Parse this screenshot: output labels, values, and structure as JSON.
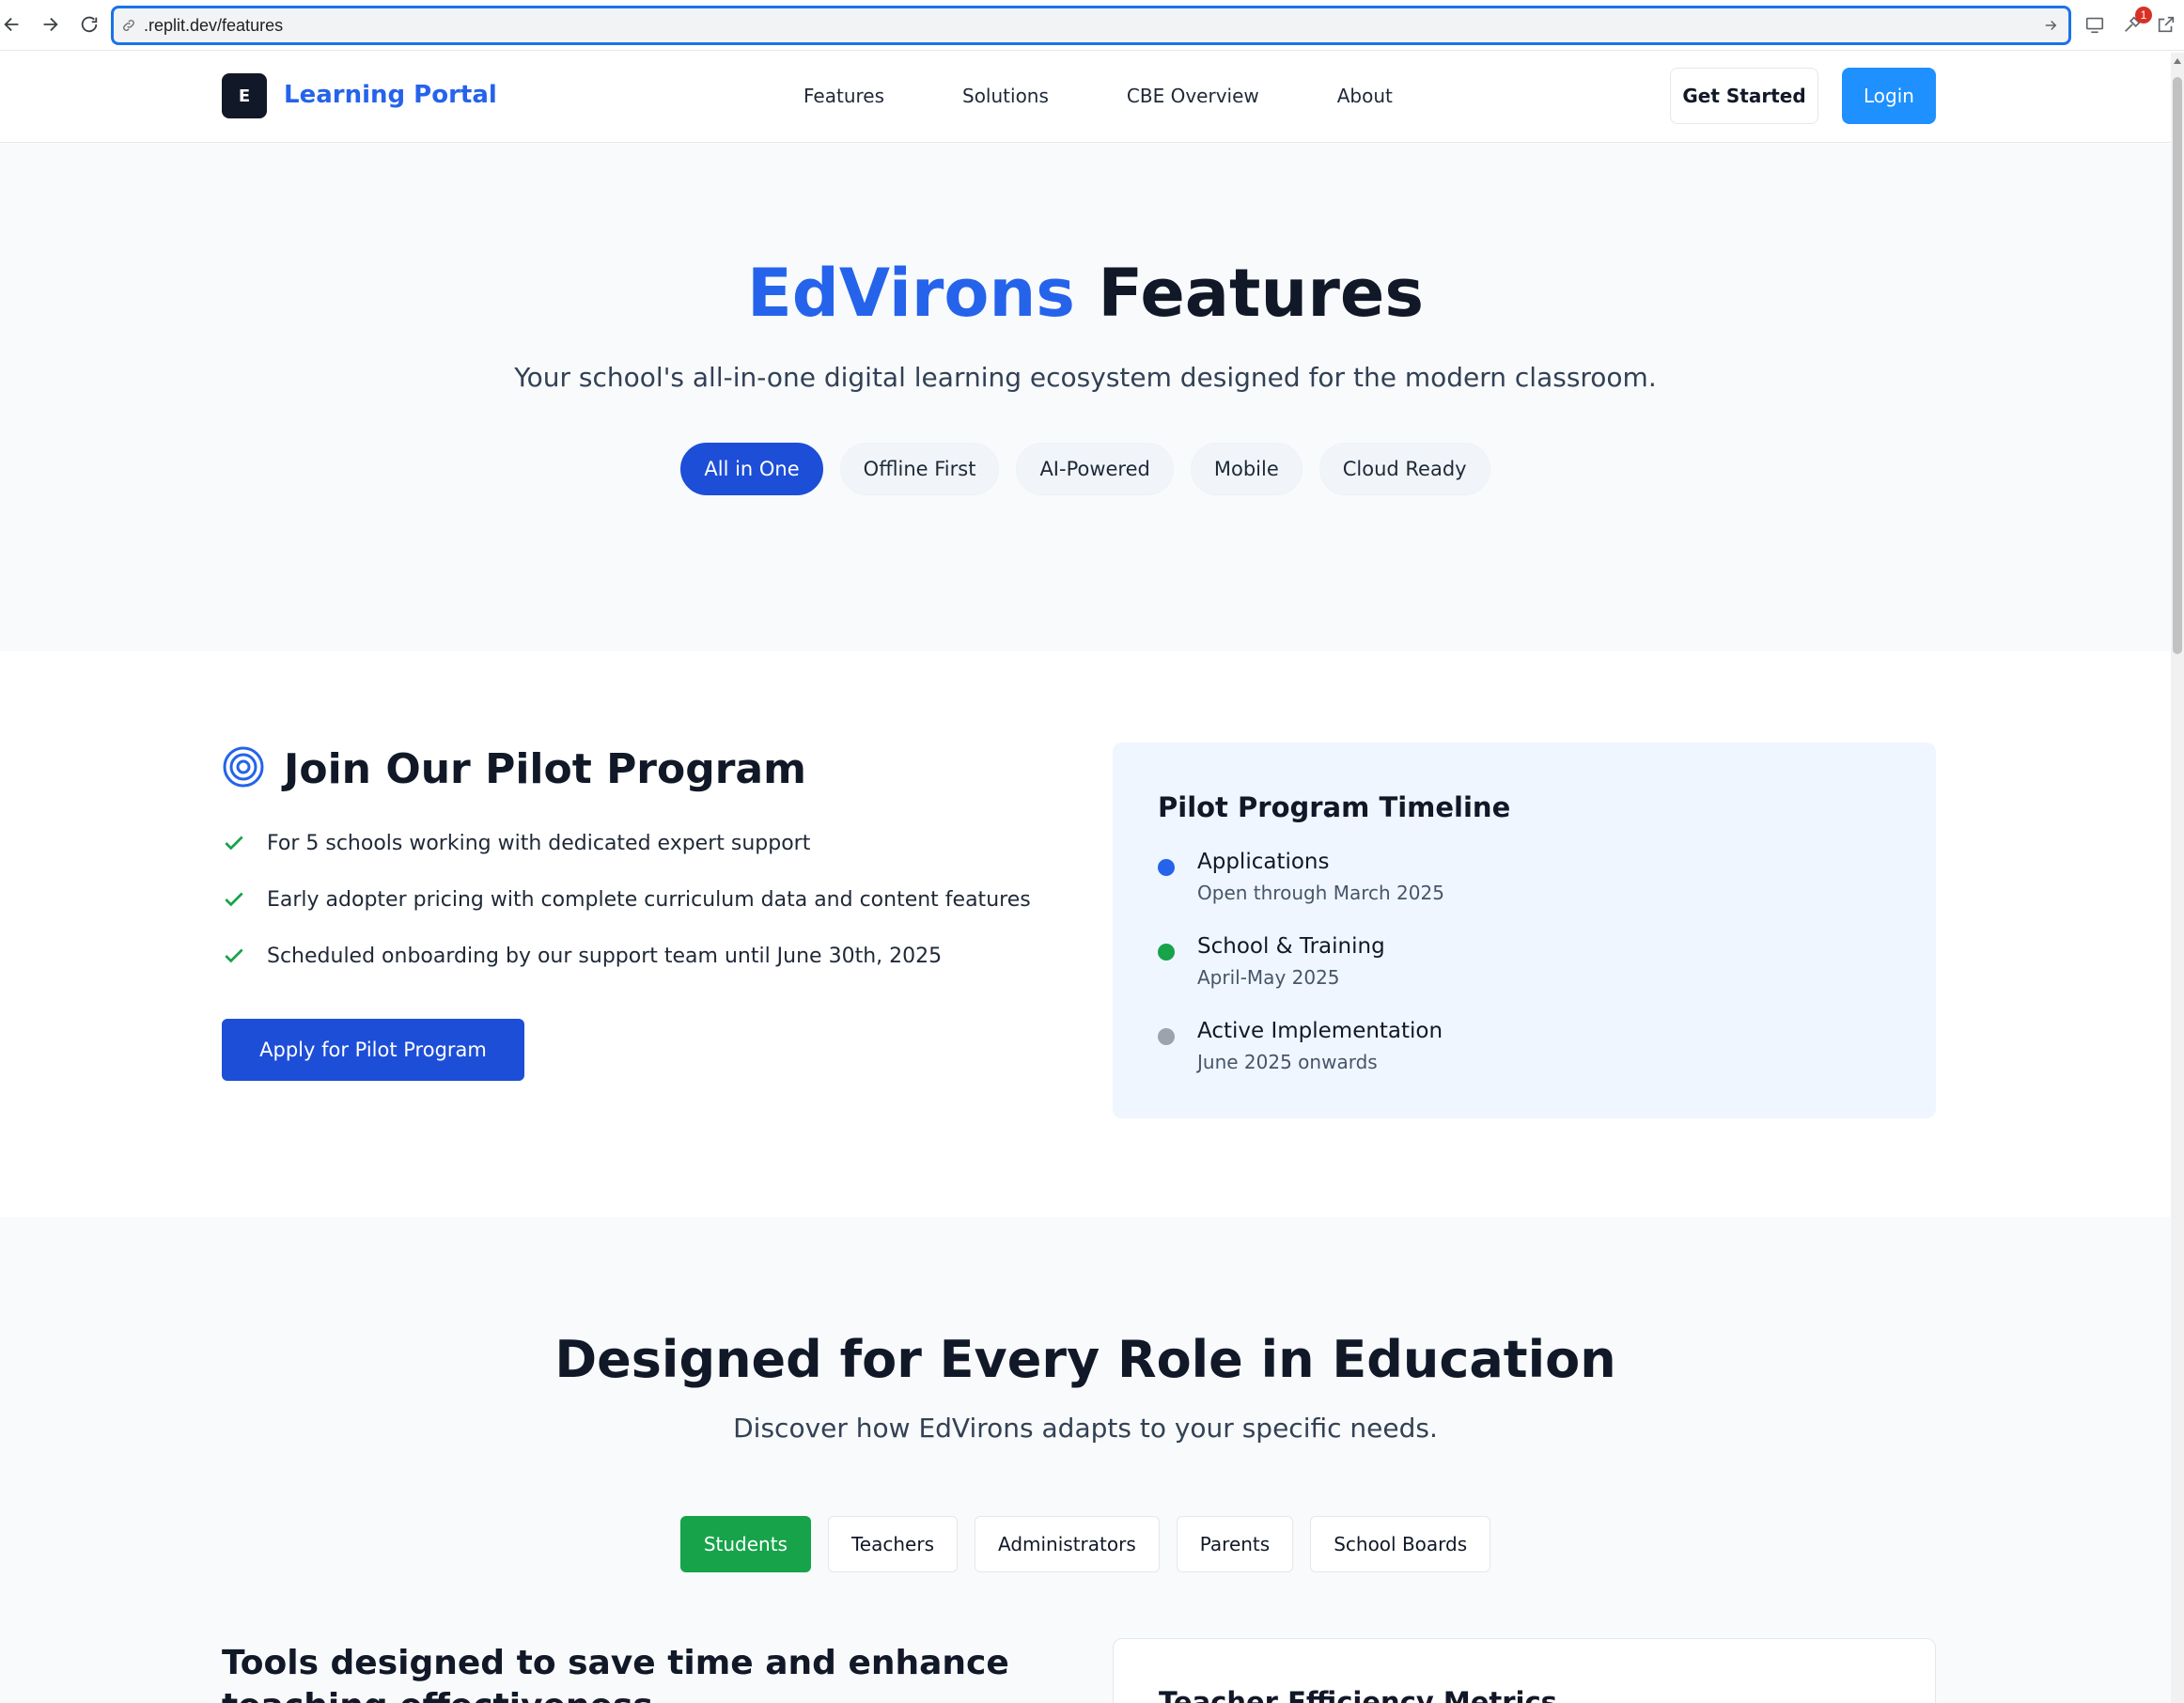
{
  "browser": {
    "url": ".replit.dev/features",
    "extension_badge": "1"
  },
  "header": {
    "logo_letter": "E",
    "brand": "Learning Portal",
    "nav": [
      "Features",
      "Solutions",
      "CBE Overview",
      "About"
    ],
    "get_started": "Get Started",
    "login": "Login"
  },
  "hero": {
    "title_brand": "EdVirons",
    "title_rest": " Features",
    "subtitle": "Your school's all-in-one digital learning ecosystem designed for the modern classroom.",
    "pills": [
      "All in One",
      "Offline First",
      "AI-Powered",
      "Mobile",
      "Cloud Ready"
    ],
    "active_pill": "All in One"
  },
  "pilot": {
    "title": "Join Our Pilot Program",
    "bullets": [
      "For 5 schools working with dedicated expert support",
      "Early adopter pricing with complete curriculum data and content features",
      "Scheduled onboarding by our support team until June 30th, 2025"
    ],
    "apply_button": "Apply for Pilot Program",
    "timeline": {
      "title": "Pilot Program Timeline",
      "items": [
        {
          "label": "Applications",
          "sub": "Open through March 2025",
          "color": "#2563eb"
        },
        {
          "label": "School & Training",
          "sub": "April-May 2025",
          "color": "#16a34a"
        },
        {
          "label": "Active Implementation",
          "sub": "June 2025 onwards",
          "color": "#9ca3af"
        }
      ]
    }
  },
  "roles": {
    "title": "Designed for Every Role in Education",
    "subtitle": "Discover how EdVirons adapts to your specific needs.",
    "tabs": [
      "Students",
      "Teachers",
      "Administrators",
      "Parents",
      "School Boards"
    ],
    "active_tab": "Students",
    "tools_title": "Tools designed to save time and enhance teaching effectiveness",
    "metrics_title": "Teacher Efficiency Metrics"
  },
  "colors": {
    "accent": "#2563eb",
    "login": "#1e90ff",
    "success": "#16a34a"
  }
}
